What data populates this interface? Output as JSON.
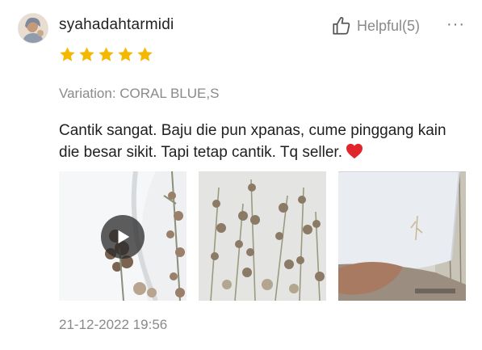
{
  "review": {
    "username": "syahadahtarmidi",
    "helpful_label": "Helpful(5)",
    "more_label": "···",
    "rating": 5,
    "variation": "Variation: CORAL BLUE,S",
    "comment": "Cantik sangat. Baju die pun xpanas, cume pinggang kain die besar sikit. Tapi tetap cantik. Tq seller.",
    "date": "21-12-2022 19:56"
  },
  "icons": {
    "avatar": "user-avatar",
    "helpful": "thumbs-up-icon",
    "more": "more-options-icon",
    "star": "star-icon",
    "heart": "red-heart-emoji",
    "play": "play-icon"
  },
  "media": [
    {
      "kind": "video",
      "description_icon": "play-icon"
    },
    {
      "kind": "image"
    },
    {
      "kind": "image"
    }
  ],
  "colors": {
    "star": "#f5b800",
    "heart": "#e0262c",
    "muted_text": "#8a8a8a"
  }
}
